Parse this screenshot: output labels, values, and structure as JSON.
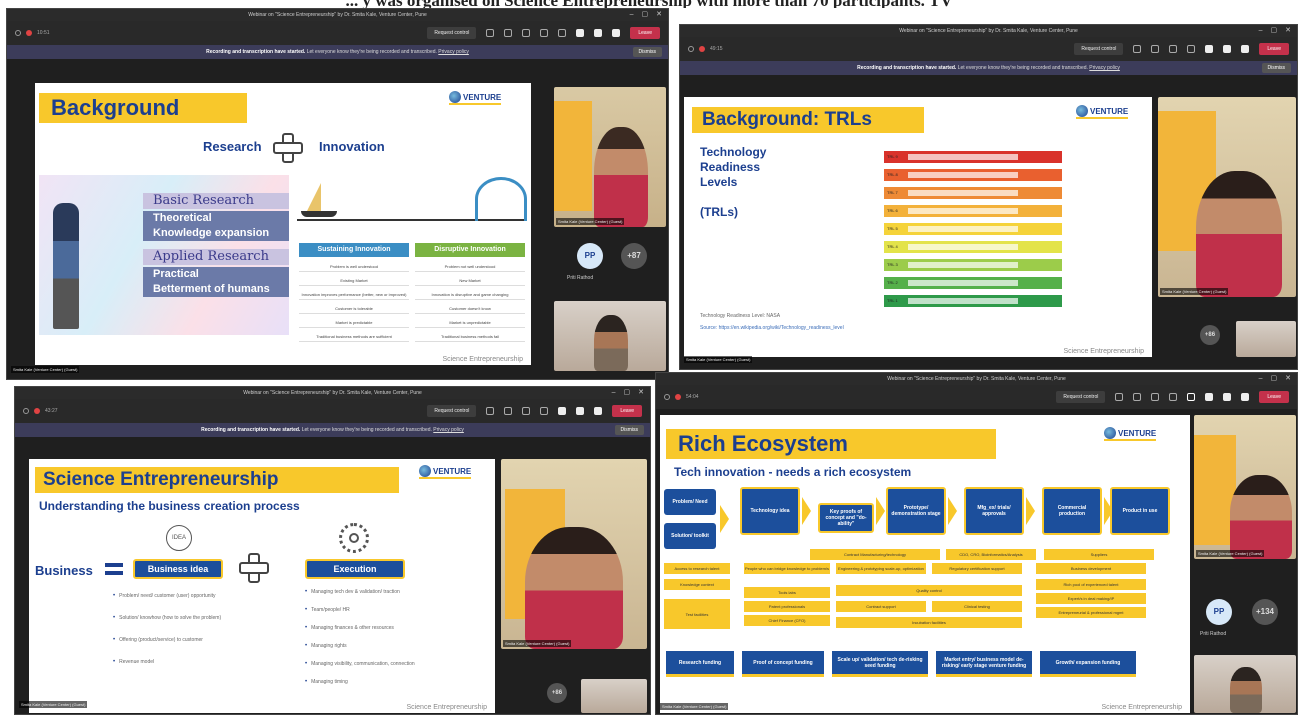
{
  "caption": "... y  was organised on Science Entrepreneurship with more than 70 participants. TV",
  "colors": {
    "accent": "#f8c82b",
    "brand_blue": "#1c3f8f",
    "leave_red": "#c4314b",
    "banner": "#3c3c5a"
  },
  "windows": [
    {
      "title": "Webinar on \"Science Entrepreneurship\" by Dr. Smita Kale, Venture Center, Pune",
      "timer": "10:51",
      "request_control": "Request control",
      "leave": "Leave",
      "banner_bold": "Recording and transcription have started.",
      "banner_text": "Let everyone know they're being recorded and transcribed.",
      "banner_link": "Privacy policy",
      "dismiss": "Dismiss",
      "presenter_tag": "Smita Kale (Venture Center) (Guest)",
      "slide": {
        "title": "Background",
        "logo": "VENTURE",
        "research": "Research",
        "innovation": "Innovation",
        "labels": [
          "Basic Research",
          "Theoretical",
          "Knowledge expansion",
          "Applied Research",
          "Practical",
          "Betterment of humans"
        ],
        "sustaining": "Sustaining Innovation",
        "disruptive": "Disruptive Innovation",
        "sustaining_rows": [
          "Problem is well understood",
          "Existing Market",
          "Innovation improves performance (better, new or improved) features",
          "Customer is tolerable",
          "Market is predictable",
          "Traditional business methods are sufficient"
        ],
        "disruptive_rows": [
          "Problem not well understood",
          "New Market",
          "Innovation is disruptive and game changing",
          "Customer doesn't know",
          "Market is unpredictable",
          "Traditional business methods fail"
        ],
        "footer": "Science Entrepreneurship"
      },
      "side": {
        "pp": "PP",
        "plus": "+87",
        "pp_name": "Priti Rathod",
        "tag": "Smita Kale (Venture Center) (Guest)"
      }
    },
    {
      "title": "Webinar on \"Science Entrepreneurship\" by Dr. Smita Kale, Venture Center, Pune",
      "timer": "49:15",
      "request_control": "Request control",
      "leave": "Leave",
      "banner_bold": "Recording and transcription have started.",
      "banner_text": "Let everyone know they're being recorded and transcribed.",
      "banner_link": "Privacy policy",
      "dismiss": "Dismiss",
      "presenter_tag": "Smita Kale (Venture Center) (Guest)",
      "slide": {
        "title": "Background: TRLs",
        "logo": "VENTURE",
        "side_text": [
          "Technology",
          "Readiness",
          "Levels",
          "",
          "(TRLs)"
        ],
        "trls": [
          "TRL 1",
          "TRL 2",
          "TRL 3",
          "TRL 4",
          "TRL 5",
          "TRL 6",
          "TRL 7",
          "TRL 8",
          "TRL 9"
        ],
        "trl_colors": [
          "#2e9a4a",
          "#55b04a",
          "#9ccc4a",
          "#e3e34a",
          "#f5d33a",
          "#f3b13a",
          "#ee8a35",
          "#e9602f",
          "#d9322b"
        ],
        "source1": "Technology Readiness Level: NASA",
        "source2": "Source: https://en.wikipedia.org/wiki/Technology_readiness_level",
        "footer": "Science Entrepreneurship"
      },
      "side": {
        "plus": "+86",
        "tag": "Smita Kale (Venture Center) (Guest)"
      }
    },
    {
      "title": "Webinar on \"Science Entrepreneurship\" by Dr. Smita Kale, Venture Center, Pune",
      "timer": "43:27",
      "request_control": "Request control",
      "leave": "Leave",
      "banner_bold": "Recording and transcription have started.",
      "banner_text": "Let everyone know they're being recorded and transcribed.",
      "banner_link": "Privacy policy",
      "dismiss": "Dismiss",
      "presenter_tag": "Smita Kale (Venture Center) (Guest)",
      "slide": {
        "title": "Science Entrepreneurship",
        "logo": "VENTURE",
        "subtitle": "Understanding the business creation process",
        "business": "Business",
        "idea_label": "IDEA",
        "business_idea": "Business idea",
        "execution": "Execution",
        "left_bullets": [
          "Problem/ need/ customer (user) opportunity",
          "Solution/ knowhow (how to solve the problem)",
          "Offering (product/service) to customer",
          "Revenue model"
        ],
        "right_bullets": [
          "Managing tech dev & validation/ traction",
          "Team/people/ HR",
          "Managing finances & other resources",
          "Managing rights",
          "Managing visibility, communication, connection",
          "Managing timing"
        ],
        "footer": "Science Entrepreneurship"
      },
      "side": {
        "plus": "+86",
        "tag": "Smita Kale (Venture Center) (Guest)"
      }
    },
    {
      "title": "Webinar on \"Science Entrepreneurship\" by Dr. Smita Kale, Venture Center, Pune",
      "timer": "54:04",
      "request_control": "Request control",
      "leave": "Leave",
      "presenter_tag": "Smita Kale (Venture Center) (Guest)",
      "slide": {
        "title": "Rich Ecosystem",
        "logo": "VENTURE",
        "subtitle": "Tech innovation - needs a rich ecosystem",
        "problem": "Problem/ Need",
        "solution": "Solution/ toolkit",
        "stages": [
          "Technology idea",
          "Key proofs of concept and \"do-ability\"",
          "Prototype/ demonstration stage",
          "Mfg_ex/ trials/ approvals",
          "Commercial production",
          "Product in use"
        ],
        "yellow_rows": [
          "Contract Manufacturing/technology",
          "CDO, CRO, Bioinformatics/Analysis",
          "Suppliers",
          "Access to research talent",
          "Knowledge context",
          "People who can bridge knowledge to problem/s",
          "Engineering & prototyping scale-up, optimization",
          "Regulatory certification support",
          "Business development",
          "Rich pool of experienced talent",
          "Tools labs",
          "Expert/s in deal making/IP",
          "Quality control",
          "Entrepreneurial & professional mgmt",
          "Test facilities",
          "Patent professionals",
          "Contract support",
          "Clinical testing",
          "Chief Finance (CFO)",
          "Incubation facilities"
        ],
        "funding": [
          "Research funding",
          "Proof of concept funding",
          "Scale up/ validation/ tech de-risking seed funding",
          "Market entry/ business model de-risking/ early stage venture funding",
          "Growth/ expansion funding"
        ],
        "footer": "Science Entrepreneurship"
      },
      "side": {
        "pp": "PP",
        "plus": "+134",
        "pp_name": "Priti Rathod",
        "tag": "Smita Kale (Venture Center) (Guest)"
      }
    }
  ]
}
